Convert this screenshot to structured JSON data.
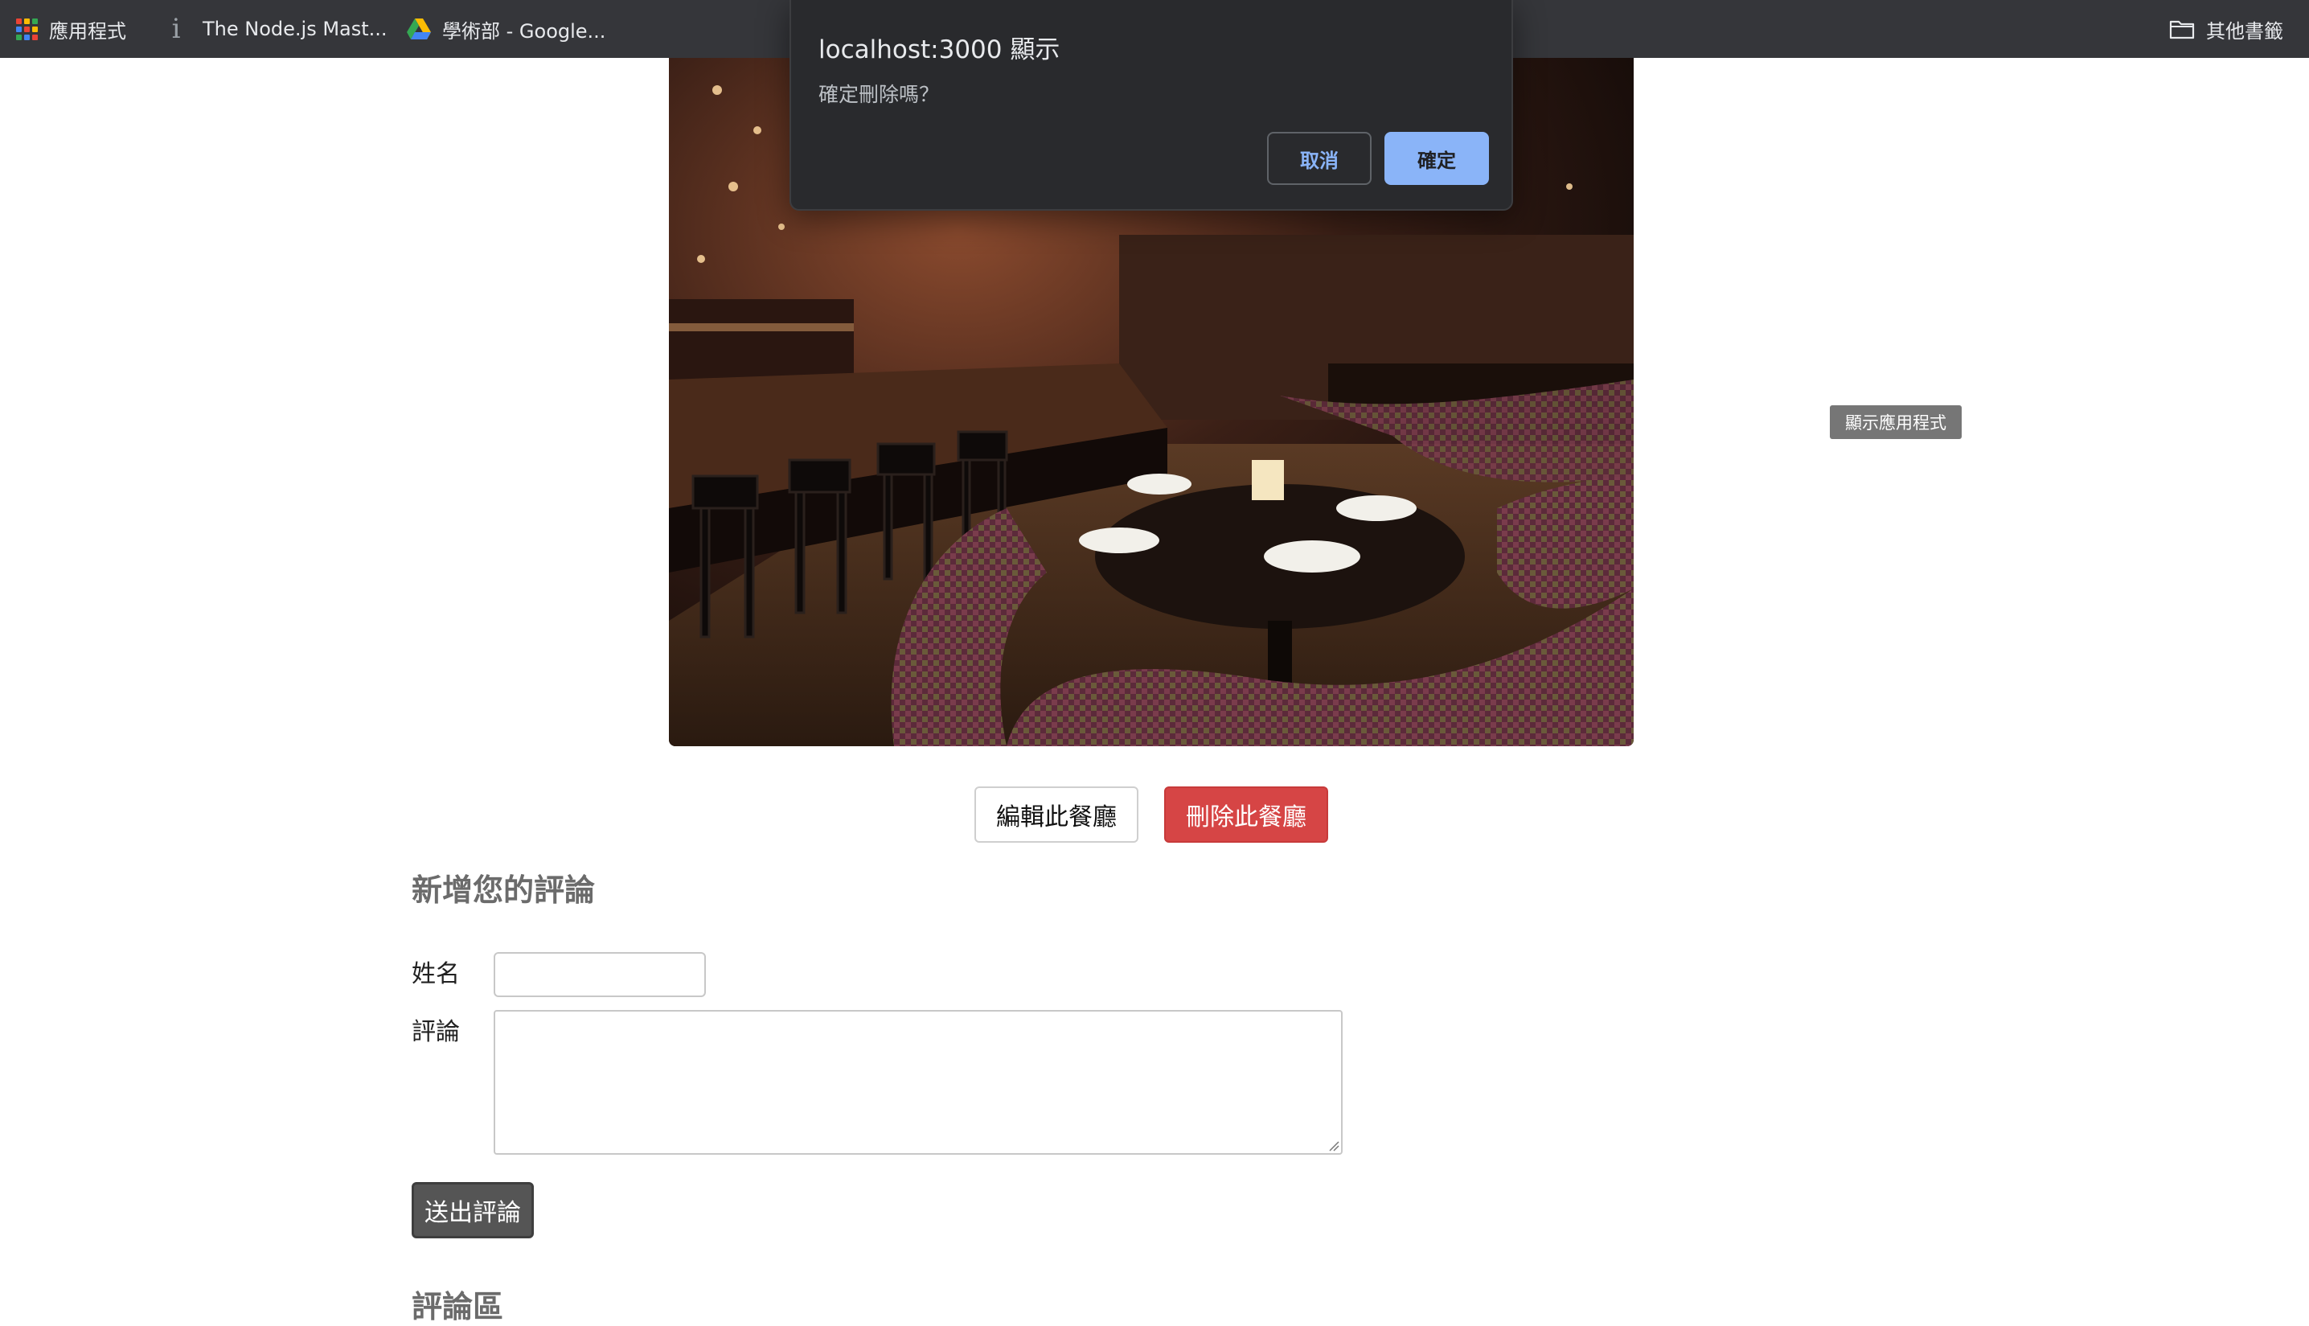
{
  "bookmarks": {
    "apps_label": "應用程式",
    "node_label": "The Node.js Mast...",
    "drive_label": "學術部 - Google...",
    "other_label": "其他書籤"
  },
  "page": {
    "show_app_badge": "顯示應用程式",
    "edit_button": "編輯此餐廳",
    "delete_button": "刪除此餐廳",
    "add_review_title": "新增您的評論",
    "name_label": "姓名",
    "comment_label": "評論",
    "submit_button": "送出評論",
    "reviews_title": "評論區"
  },
  "dialog": {
    "title": "localhost:3000 顯示",
    "message": "確定刪除嗎？",
    "cancel_label": "取消",
    "ok_label": "確定"
  },
  "colors": {
    "toolbar_bg": "#35363a",
    "dialog_bg": "#292a2d",
    "dialog_accent": "#8ab4f8",
    "delete_button": "#d64545",
    "submit_button": "#555555"
  },
  "icons": {
    "apps": "apps-grid-icon",
    "node": "info-icon",
    "drive": "google-drive-icon",
    "other": "folder-icon"
  }
}
